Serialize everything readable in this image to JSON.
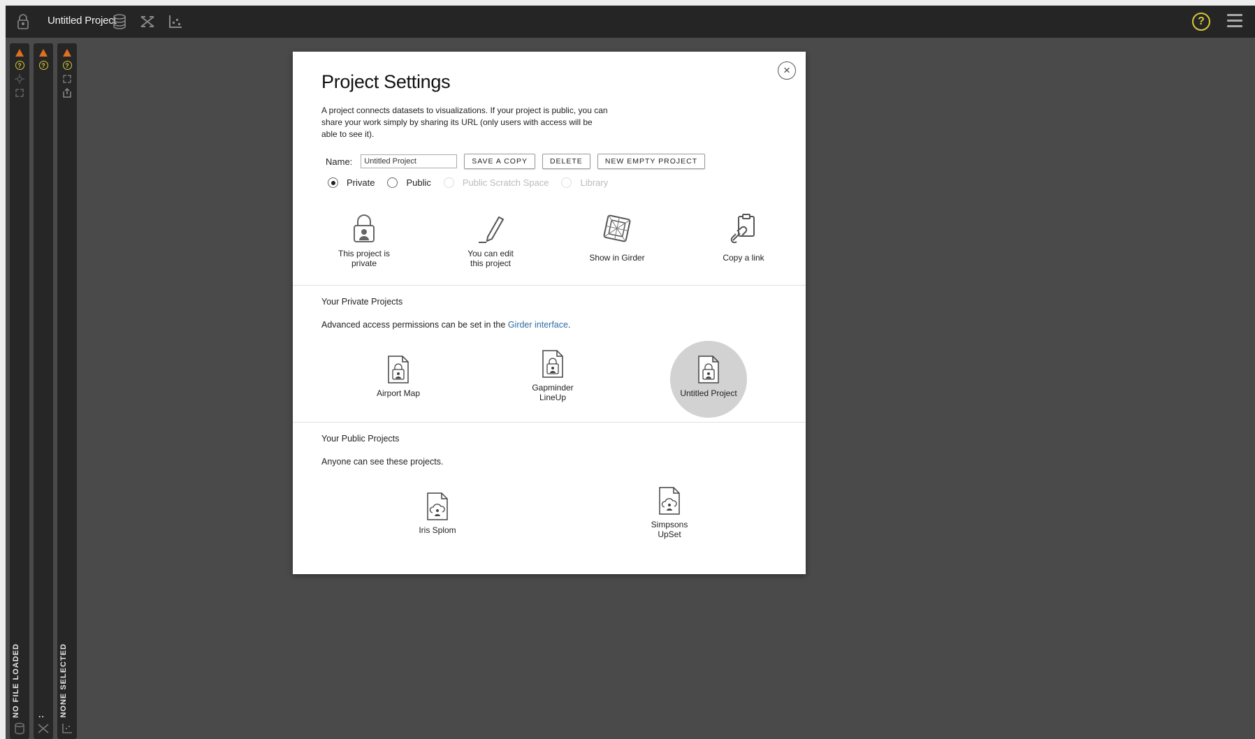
{
  "topbar": {
    "project_title": "Untitled Project"
  },
  "panels": {
    "left": "NO FILE LOADED",
    "middle": ":",
    "right": "NONE SELECTED"
  },
  "modal": {
    "title": "Project Settings",
    "description": "A project connects datasets to visualizations. If your project is public, you can share your work simply by sharing its URL (only users with access will be able to see it).",
    "name_label": "Name:",
    "name_value": "Untitled Project",
    "buttons": {
      "save_copy": "SAVE A COPY",
      "delete": "DELETE",
      "new_empty": "NEW EMPTY PROJECT"
    },
    "visibility": {
      "selected": "Private",
      "options": [
        "Private",
        "Public",
        "Public Scratch Space",
        "Library"
      ]
    },
    "actions": {
      "private_status": [
        "This project is",
        "private"
      ],
      "edit_status": [
        "You can edit",
        "this project"
      ],
      "show_in_girder": "Show in Girder",
      "copy_link": "Copy a link"
    },
    "private_section": {
      "title": "Your Private Projects",
      "desc_prefix": "Advanced access permissions can be set in the ",
      "desc_link": "Girder interface",
      "desc_suffix": ".",
      "projects": [
        {
          "name_line1": "Airport Map",
          "name_line2": ""
        },
        {
          "name_line1": "Gapminder",
          "name_line2": "LineUp"
        },
        {
          "name_line1": "Untitled Project",
          "name_line2": ""
        }
      ]
    },
    "public_section": {
      "title": "Your Public Projects",
      "desc": "Anyone can see these projects.",
      "projects": [
        {
          "name_line1": "Iris Splom",
          "name_line2": ""
        },
        {
          "name_line1": "Simpsons",
          "name_line2": "UpSet"
        }
      ]
    }
  },
  "colors": {
    "warning": "#e0701e",
    "help": "#d8c83a",
    "link": "#2e6da4"
  }
}
